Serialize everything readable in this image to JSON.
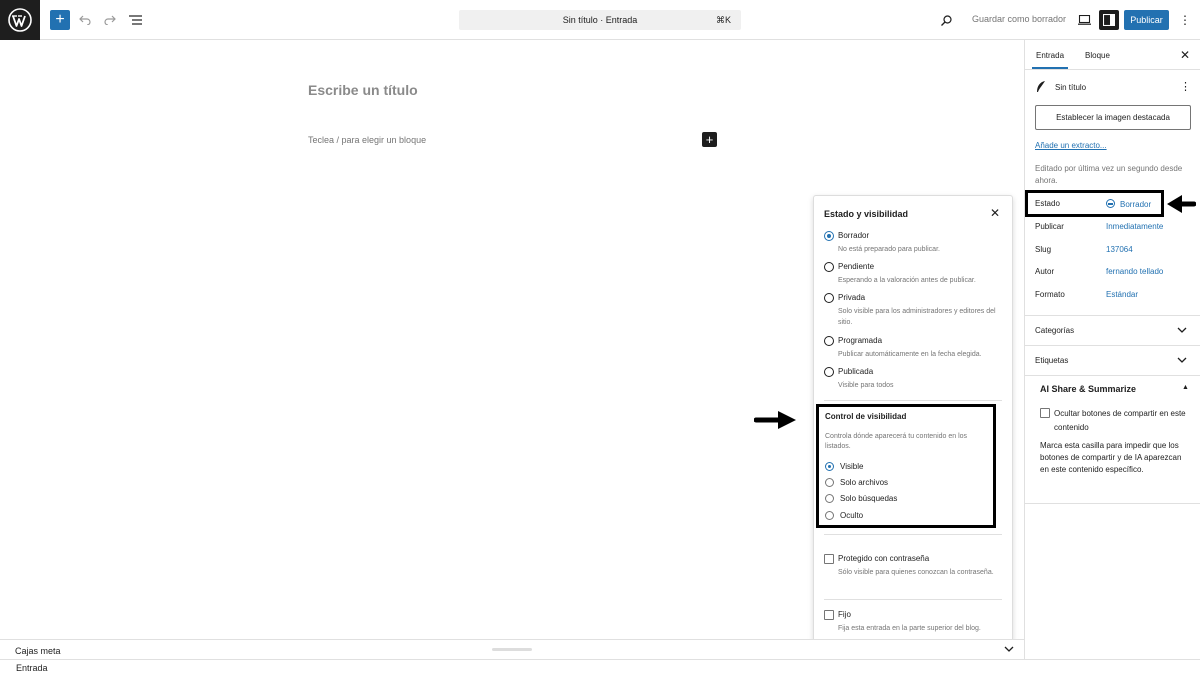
{
  "topbar": {
    "document_title": "Sin título · Entrada",
    "shortcut": "⌘K",
    "save_draft": "Guardar como borrador",
    "publish": "Publicar"
  },
  "canvas": {
    "title_placeholder": "Escribe un título",
    "block_placeholder": "Teclea / para elegir un bloque"
  },
  "popover": {
    "title": "Estado y visibilidad",
    "statuses": [
      {
        "label": "Borrador",
        "desc": "No está preparado para publicar.",
        "selected": true
      },
      {
        "label": "Pendiente",
        "desc": "Esperando a la valoración antes de publicar.",
        "selected": false
      },
      {
        "label": "Privada",
        "desc": "Solo visible para los administradores y editores del sitio.",
        "selected": false
      },
      {
        "label": "Programada",
        "desc": "Publicar automáticamente en la fecha elegida.",
        "selected": false
      },
      {
        "label": "Publicada",
        "desc": "Visible para todos",
        "selected": false
      }
    ],
    "visibility": {
      "title": "Control de visibilidad",
      "desc": "Controla dónde aparecerá tu contenido en los listados.",
      "options": [
        {
          "label": "Visible",
          "selected": true
        },
        {
          "label": "Solo archivos",
          "selected": false
        },
        {
          "label": "Solo búsquedas",
          "selected": false
        },
        {
          "label": "Oculto",
          "selected": false
        }
      ]
    },
    "password": {
      "label": "Protegido con contraseña",
      "desc": "Sólo visible para quienes conozcan la contraseña."
    },
    "sticky": {
      "label": "Fijo",
      "desc": "Fija esta entrada en la parte superior del blog."
    }
  },
  "sidebar": {
    "tabs": [
      "Entrada",
      "Bloque"
    ],
    "post_title": "Sin título",
    "featured_image": "Establecer la imagen destacada",
    "excerpt_link": "Añade un extracto...",
    "edited_text": "Editado por última vez un segundo desde ahora.",
    "properties": [
      {
        "key": "Estado",
        "value": "Borrador"
      },
      {
        "key": "Publicar",
        "value": "Inmediatamente"
      },
      {
        "key": "Slug",
        "value": "137064"
      },
      {
        "key": "Autor",
        "value": "fernando tellado"
      },
      {
        "key": "Formato",
        "value": "Estándar"
      }
    ],
    "panels": [
      "Categorías",
      "Etiquetas"
    ],
    "ai_share": {
      "title": "AI Share & Summarize",
      "checkbox_label": "Ocultar botones de compartir en este contenido",
      "desc": "Marca esta casilla para impedir que los botones de compartir y de IA aparezcan en este contenido específico."
    }
  },
  "bottom": {
    "meta_boxes": "Cajas meta",
    "footer_label": "Entrada"
  },
  "colors": {
    "accent": "#2271b1",
    "dark": "#1e1e1e",
    "muted": "#757575"
  },
  "icons": [
    "wordpress-logo-icon",
    "plus-icon",
    "undo-icon",
    "redo-icon",
    "list-view-icon",
    "search-icon",
    "desktop-preview-icon",
    "sidebar-toggle-icon",
    "more-vertical-icon",
    "close-icon",
    "feather-icon",
    "chevron-down-icon",
    "chevron-up-icon",
    "arrow-right-icon",
    "arrow-left-icon"
  ]
}
